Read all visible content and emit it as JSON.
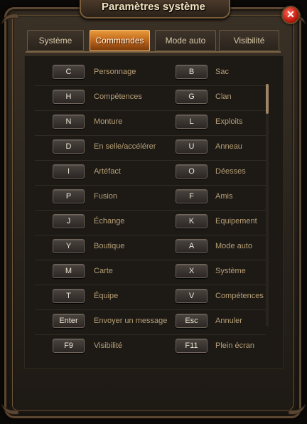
{
  "window": {
    "title": "Paramètres système",
    "close_glyph": "✕"
  },
  "tabs": [
    {
      "label": "Système",
      "active": false
    },
    {
      "label": "Commandes",
      "active": true
    },
    {
      "label": "Mode auto",
      "active": false
    },
    {
      "label": "Visibilité",
      "active": false
    }
  ],
  "commands": [
    {
      "left_key": "C",
      "left_action": "Personnage",
      "right_key": "B",
      "right_action": "Sac"
    },
    {
      "left_key": "H",
      "left_action": "Compétences",
      "right_key": "G",
      "right_action": "Clan"
    },
    {
      "left_key": "N",
      "left_action": "Monture",
      "right_key": "L",
      "right_action": "Exploits"
    },
    {
      "left_key": "D",
      "left_action": "En selle/accélérer",
      "right_key": "U",
      "right_action": "Anneau"
    },
    {
      "left_key": "I",
      "left_action": "Artéfact",
      "right_key": "O",
      "right_action": "Déesses"
    },
    {
      "left_key": "P",
      "left_action": "Fusion",
      "right_key": "F",
      "right_action": "Amis"
    },
    {
      "left_key": "J",
      "left_action": "Échange",
      "right_key": "K",
      "right_action": "Equipement"
    },
    {
      "left_key": "Y",
      "left_action": "Boutique",
      "right_key": "A",
      "right_action": "Mode auto"
    },
    {
      "left_key": "M",
      "left_action": "Carte",
      "right_key": "X",
      "right_action": "Système"
    },
    {
      "left_key": "T",
      "left_action": "Équipe",
      "right_key": "V",
      "right_action": "Compétences"
    },
    {
      "left_key": "Enter",
      "left_action": "Envoyer un message",
      "right_key": "Esc",
      "right_action": "Annuler"
    },
    {
      "left_key": "F9",
      "left_action": "Visibilité",
      "right_key": "F11",
      "right_action": "Plein écran"
    }
  ]
}
